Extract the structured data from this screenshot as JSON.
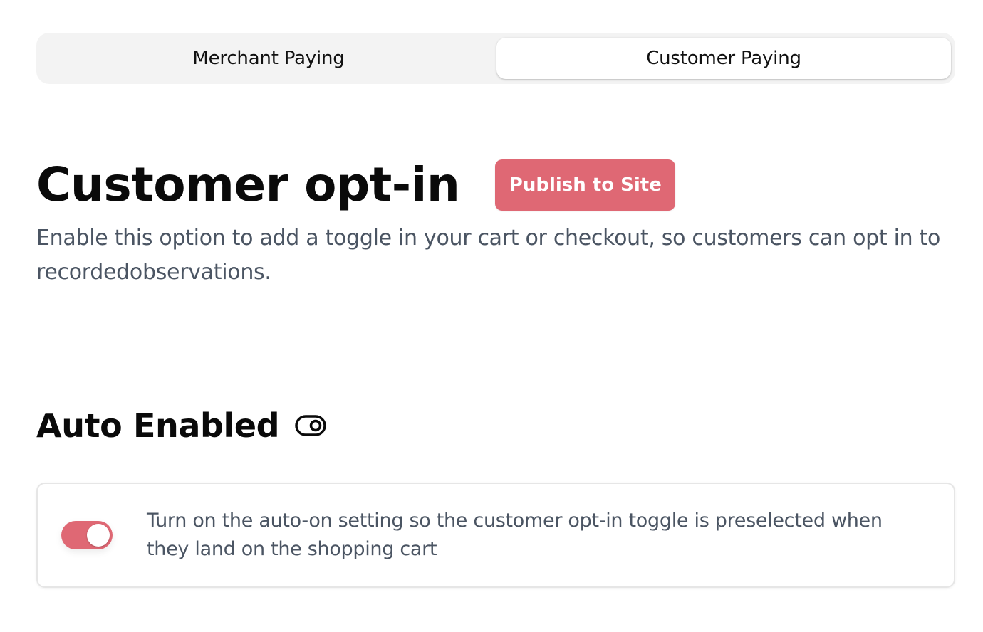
{
  "tabs": {
    "merchant_label": "Merchant Paying",
    "customer_label": "Customer Paying",
    "active": "Customer Paying"
  },
  "header": {
    "title": "Customer opt-in",
    "publish_label": "Publish to Site"
  },
  "description": "Enable this option to add a toggle in your cart or checkout, so customers can opt in to recordedobservations.",
  "auto_section": {
    "title": "Auto Enabled",
    "icon": "toggle-icon",
    "toggle_on": true,
    "text": "Turn on the auto-on setting so the customer opt-in toggle is preselected when they land on the shopping cart"
  },
  "colors": {
    "accent": "#df6874",
    "tab_track": "#f3f3f3",
    "muted_text": "#4b5563"
  }
}
